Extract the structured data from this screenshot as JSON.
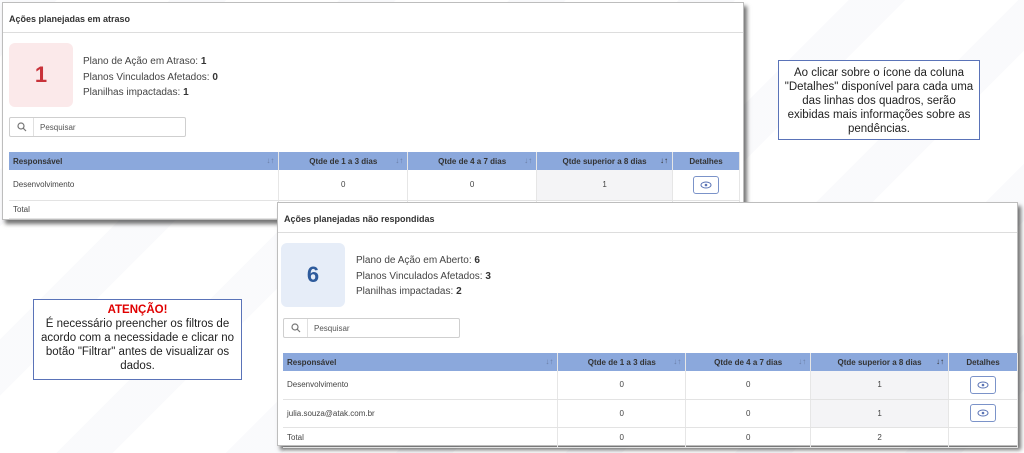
{
  "panel_overdue": {
    "title": "Ações planejadas em atraso",
    "big_number": "1",
    "stats": [
      {
        "label": "Plano de Ação em Atraso:",
        "value": "1"
      },
      {
        "label": "Planos Vinculados Afetados:",
        "value": "0"
      },
      {
        "label": "Planilhas impactadas:",
        "value": "1"
      }
    ],
    "search_placeholder": "Pesquisar",
    "columns": [
      "Responsável",
      "Qtde de 1 a 3 dias",
      "Qtde de 4 a 7 dias",
      "Qtde superior a 8 dias",
      "Detalhes"
    ],
    "rows": [
      {
        "responsavel": "Desenvolvimento",
        "q1": "0",
        "q2": "0",
        "q3": "1"
      }
    ],
    "total_label": "Total"
  },
  "panel_unanswered": {
    "title": "Ações planejadas não respondidas",
    "big_number": "6",
    "stats": [
      {
        "label": "Plano de Ação em Aberto:",
        "value": "6"
      },
      {
        "label": "Planos Vinculados Afetados:",
        "value": "3"
      },
      {
        "label": "Planilhas impactadas:",
        "value": "2"
      }
    ],
    "search_placeholder": "Pesquisar",
    "columns": [
      "Responsável",
      "Qtde de 1 a 3 dias",
      "Qtde de 4 a 7 dias",
      "Qtde superior a 8 dias",
      "Detalhes"
    ],
    "rows": [
      {
        "responsavel": "Desenvolvimento",
        "q1": "0",
        "q2": "0",
        "q3": "1"
      },
      {
        "responsavel": "julia.souza@atak.com.br",
        "q1": "0",
        "q2": "0",
        "q3": "1"
      }
    ],
    "total": {
      "label": "Total",
      "q1": "0",
      "q2": "0",
      "q3": "2"
    }
  },
  "note_details": {
    "text": "Ao clicar sobre o ícone da coluna \"Detalhes\" disponível para cada uma das linhas dos quadros, serão exibidas mais informações sobre as pendências."
  },
  "note_warning": {
    "title": "ATENÇÃO!",
    "text": "É necessário preencher os filtros de acordo com a necessidade e clicar no botão \"Filtrar\" antes de visualizar os dados."
  },
  "colors": {
    "header_blue": "#8ba8dc",
    "overdue_box_bg": "#fbe9ea",
    "overdue_number": "#c8323a",
    "open_box_bg": "#e6edf8",
    "open_number": "#2e5b9c",
    "note_border": "#5a73b8",
    "warning_red": "#e00000"
  },
  "icons": {
    "search": "magnifier-icon",
    "details": "eye-icon",
    "sort": "sort-arrows-icon"
  }
}
